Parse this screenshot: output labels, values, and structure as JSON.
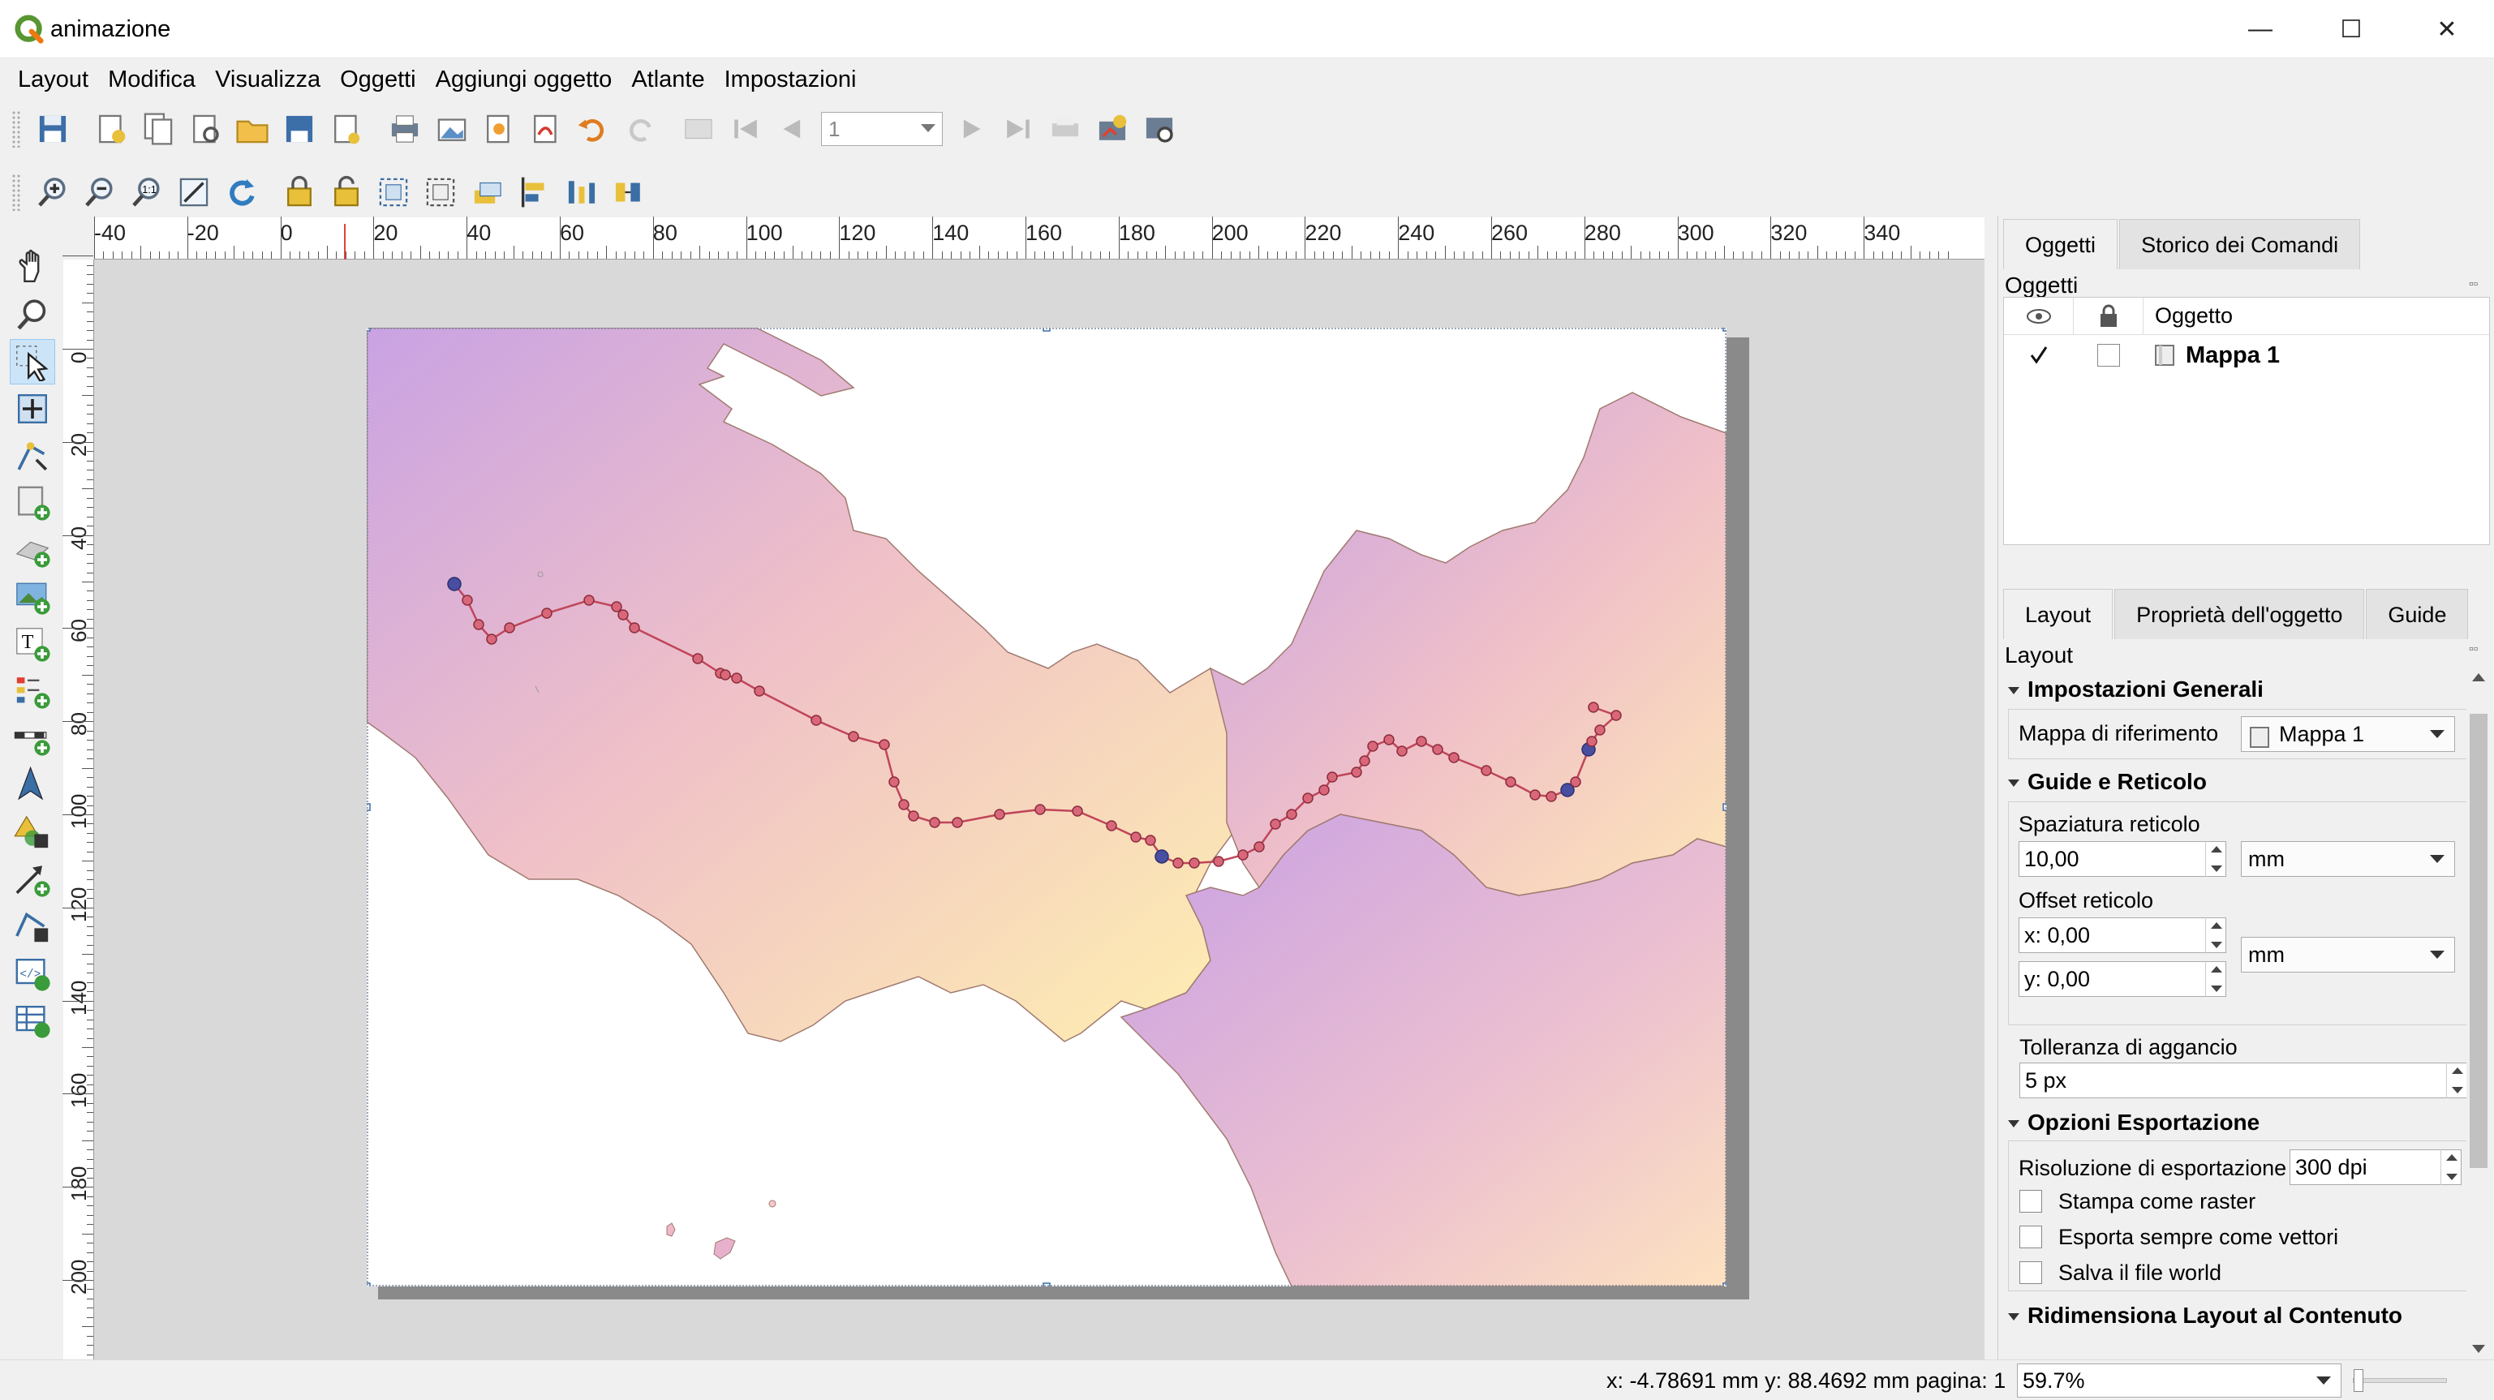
{
  "window": {
    "title": "animazione",
    "minimize": "—",
    "maximize": "☐",
    "close": "✕"
  },
  "menu": [
    "Layout",
    "Modifica",
    "Visualizza",
    "Oggetti",
    "Aggiungi oggetto",
    "Atlante",
    "Impostazioni"
  ],
  "toolbar": {
    "page_value": "1"
  },
  "ruler": {
    "h_labels": [
      "-40",
      "-20",
      "0",
      "20",
      "40",
      "60",
      "80",
      "100",
      "120",
      "140",
      "160",
      "180",
      "200",
      "220",
      "240",
      "260",
      "280",
      "300",
      "320",
      "340"
    ],
    "v_labels": [
      "0",
      "20",
      "40",
      "60",
      "80",
      "100",
      "120",
      "140",
      "160",
      "180",
      "200",
      "20"
    ]
  },
  "objects_panel": {
    "tabs": [
      "Oggetti",
      "Storico dei Comandi"
    ],
    "title": "Oggetti",
    "column": "Oggetto",
    "items": [
      {
        "name": "Mappa 1",
        "visible": true,
        "locked": false
      }
    ]
  },
  "layout_panel": {
    "tabs": [
      "Layout",
      "Proprietà dell'oggetto",
      "Guide"
    ],
    "title": "Layout",
    "general": {
      "header": "Impostazioni Generali",
      "ref_map_label": "Mappa di riferimento",
      "ref_map_value": "Mappa 1"
    },
    "grid": {
      "header": "Guide e Reticolo",
      "spacing_label": "Spaziatura reticolo",
      "spacing_value": "10,00",
      "spacing_unit": "mm",
      "offset_label": "Offset reticolo",
      "offset_x": "x: 0,00",
      "offset_y": "y: 0,00",
      "offset_unit": "mm",
      "snap_label": "Tolleranza di aggancio",
      "snap_value": "5 px"
    },
    "export": {
      "header": "Opzioni Esportazione",
      "resolution_label": "Risoluzione di esportazione",
      "resolution_value": "300 dpi",
      "options": [
        "Stampa come raster",
        "Esporta sempre come vettori",
        "Salva il file world"
      ]
    },
    "resize": {
      "header": "Ridimensiona Layout al Contenuto"
    }
  },
  "status": {
    "coords": "x: -4.78691 mm y: 88.4692 mm pagina: 1",
    "zoom": "59.7%"
  },
  "colors": {
    "accent": "#2c8a3a",
    "route": "#c0455a",
    "marker_blue": "#4a4ea0"
  }
}
